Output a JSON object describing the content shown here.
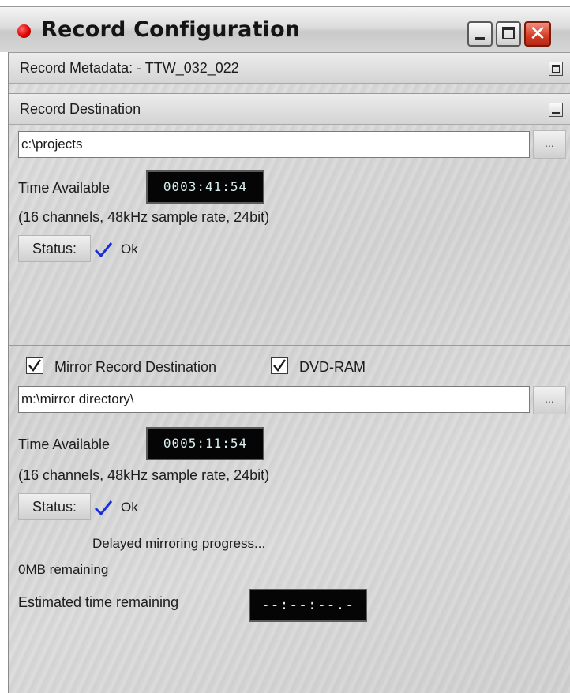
{
  "window": {
    "title": "Record Configuration",
    "accent": "#e00000"
  },
  "metadata": {
    "label": "Record Metadata:  -  TTW_032_022"
  },
  "destination": {
    "header": "Record Destination",
    "path": "c:\\projects",
    "browse_label": "...",
    "time_label": "Time Available",
    "time_value": "0003:41:54",
    "info": "(16 channels, 48kHz sample rate, 24bit)",
    "status_label": "Status:",
    "status_value": "Ok"
  },
  "mirror": {
    "mirror_checkbox_label": "Mirror Record Destination",
    "mirror_checked": true,
    "dvd_checkbox_label": "DVD-RAM",
    "dvd_checked": true,
    "path": "m:\\mirror directory\\",
    "browse_label": "...",
    "time_label": "Time Available",
    "time_value": "0005:11:54",
    "info": "(16 channels, 48kHz sample rate, 24bit)",
    "status_label": "Status:",
    "status_value": "Ok",
    "progress_label": "Delayed mirroring progress...",
    "remaining_label": "0MB remaining",
    "estimated_label": "Estimated time remaining",
    "estimated_value": "--:--:--.-"
  },
  "icons": {
    "record": "record-dot-icon",
    "minimize": "minimize-icon",
    "maximize": "maximize-icon",
    "close": "close-icon",
    "status_ok": "checkmark-icon"
  }
}
